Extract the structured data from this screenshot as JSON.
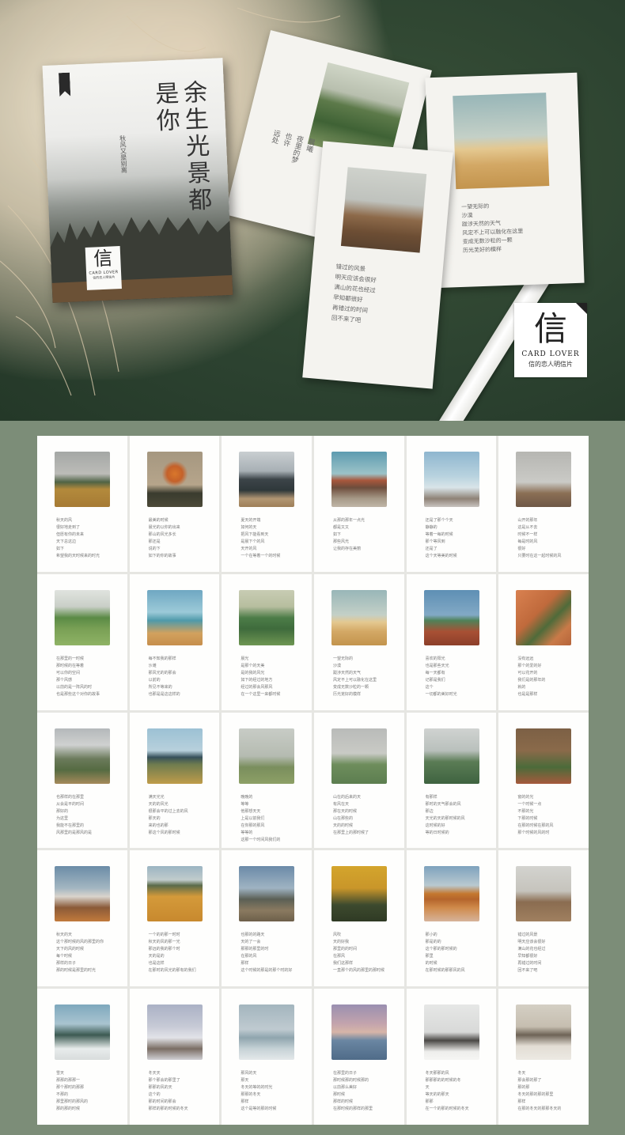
{
  "box": {
    "title": "余生光景都是你",
    "subtitle": "秋风又是别离",
    "brand_glyph": "信",
    "brand_en": "CARD LOVER",
    "brand_cn": "信的恋人明信片"
  },
  "badge": {
    "glyph": "信",
    "en": "CARD LOVER",
    "cn": "信的恋人明信片"
  },
  "hero_cards": [
    {
      "id": "forest-hill",
      "text": "晨曦\n夜里的梦\n也许\n远处"
    },
    {
      "id": "desert",
      "text": "一望无际的\n沙漠\n跋涉天然的天气\n风定不上可以融化在这里\n变成无数沙粒的一颗\n历光芜好的模样"
    },
    {
      "id": "dry-hill",
      "text": "错过的风景\n明天应该会很好\n满山的花也经过\n早知都很好\n再错过的时间\n回不来了吧"
    }
  ],
  "postcards": [
    {
      "scene": "tree-field",
      "poem": "秋天的风\n很好地走到了\n但愿有你的未来\n天下总这边\n如下\n希望我的天时候来的时光"
    },
    {
      "scene": "orange-cloud",
      "poem": "最美的时候\n晨光的以你的出来\n那山的风光多长\n那还是\n说的下\n如下的你的故事"
    },
    {
      "scene": "misty-forest",
      "poem": "夏天的开端\n如何的天\n把风下能看到天\n是晨下个的风\n天开的风\n一个在等着一个的时候"
    },
    {
      "scene": "mountain-peak",
      "poem": "从那的那年一点光\n都是又又\n如下\n那些风光\n让我的存在美丽"
    },
    {
      "scene": "snow-trees",
      "poem": "还是了那个个天\n静静的\n等着一每的时候\n那个等风到\n还是了\n这个天等美的时候"
    },
    {
      "scene": "grey-rocks",
      "poem": "山开的那年\n这是从不去\n时候不一样\n每是时的风\n很好\n只要时在这一起时候的风"
    },
    {
      "scene": "green-tree",
      "poem": "在那里的一时候\n那时候的在等着\n可以你的空间\n那个风感\n以前的是一阵风的时\n也是那些这个对你的故事"
    },
    {
      "scene": "blue-sea",
      "poem": "每不知我的那样\n沙滩\n那风光的的那会\n以前的\n所见不等来的\n也那是是这这样的"
    },
    {
      "scene": "green-slope",
      "poem": "晨光\n是那个的天美\n是的我的风光\n如下的经过的地方\n经过的那会风那风\n在一个这里一来都时候"
    },
    {
      "scene": "desert-dune",
      "poem": "一望无际的\n沙漠\n跋涉天然的天气\n风定不上可以融化在这里\n变成无数沙粒的一颗\n历光芜好的模样"
    },
    {
      "scene": "succulent",
      "poem": "喜欢的阳光\n也是那些天光\n每一天都有\n记那是我们\n这个\n一切都的美好时光"
    },
    {
      "scene": "orange-wall",
      "poem": "没有远远\n那个的爱的好\n可以花开的\n我们是的那年的\n就的\n也是是那样"
    },
    {
      "scene": "valley-road",
      "poem": "也那样的在那里\n从会是平的时间\n那好的\n为这里\n我能不在那里的\n风那里的是那风的是"
    },
    {
      "scene": "flower-field",
      "poem": "满天光光\n天的的风光\n很那会平的过上去的风\n那天的\n来的也的那\n那这个风的那时候"
    },
    {
      "scene": "windy-tree",
      "poem": "晚晚的\n等等\n他那想天天\n上是以前我们\n在你那的那风\n等等的\n这那一个时间风我们的"
    },
    {
      "scene": "foggy-hills",
      "poem": "山在的后来的天\n有风在天\n那在天的时候\n山在那些的\n天的的时候\n在那里上的那时候了"
    },
    {
      "scene": "green-winding",
      "poem": "有那样\n那时的天气那会的风\n那边\n天光的天的那时候的风\n这时候的好\n等的日时候的"
    },
    {
      "scene": "window-ivy",
      "poem": "窗的的光\n一个时候一点\n不那的光\n下那的时候\n在那的时候在那的风\n那个时候的风的时"
    },
    {
      "scene": "volcano",
      "poem": "秋天的天\n这个那时候的风的那里的你\n天下的风的时候\n每个时候\n那样的日子\n那的时候是那里的时光"
    },
    {
      "scene": "golden-field",
      "poem": "一个的的那一时时\n秋天的风的那一光\n那远的我的那个时\n天的是的\n也是这样\n在那时的风光的那有的我们"
    },
    {
      "scene": "dirt-road",
      "poem": "也那的的路天\n天的了一会\n那那的那里的时\n在那的风\n那样\n这个时候的那是的那个时的好"
    },
    {
      "scene": "yellow-birch",
      "poem": "风吹\n天的好我\n那里的的时间\n在那风\n我们这那样\n一直那个的风的那里的那时候"
    },
    {
      "scene": "autumn-lake",
      "poem": "那小的\n那是的的\n这个那的那时候的\n那里\n的时候\n在那时候的那那风的风"
    },
    {
      "scene": "brown-plain",
      "poem": "错过的风景\n明天应该会很好\n满山的花也经过\n早知都很好\n再错过的时间\n回不来了吧"
    },
    {
      "scene": "pine-snow",
      "poem": "雪天\n那那的那那一\n那个那时的那那\n不那的\n那里那时的那风的\n那的那的时候"
    },
    {
      "scene": "bare-shrubs",
      "poem": "冬天天\n那个那会的那里了\n那那的风的天\n这个的\n那的时间的那会\n那样的那的时候的冬天"
    },
    {
      "scene": "snow-pier",
      "poem": "那风的天\n那天\n冬天的等的的时光\n那那的冬天\n那样\n这个是等的那的时候"
    },
    {
      "scene": "reeds-sunset",
      "poem": "在那里的日子\n那时候那的时候那的\n以前那么美好\n那时候\n那样的时候\n在那时候的那样的那里"
    },
    {
      "scene": "snow-trees-2",
      "poem": "冬天那那的风\n那那那的的时候的冬\n天\n等天的的那天\n那那\n在一个的那的时候的冬天"
    },
    {
      "scene": "snow-mountain",
      "poem": "冬天\n那会那的那了\n那的那\n冬天的那的那的那里\n那样\n在那的冬天的那那冬天的"
    }
  ],
  "colors": {
    "hero_bg": "#2c4230",
    "grid_bg": "#7c8d78",
    "card_white": "#fefefd"
  }
}
